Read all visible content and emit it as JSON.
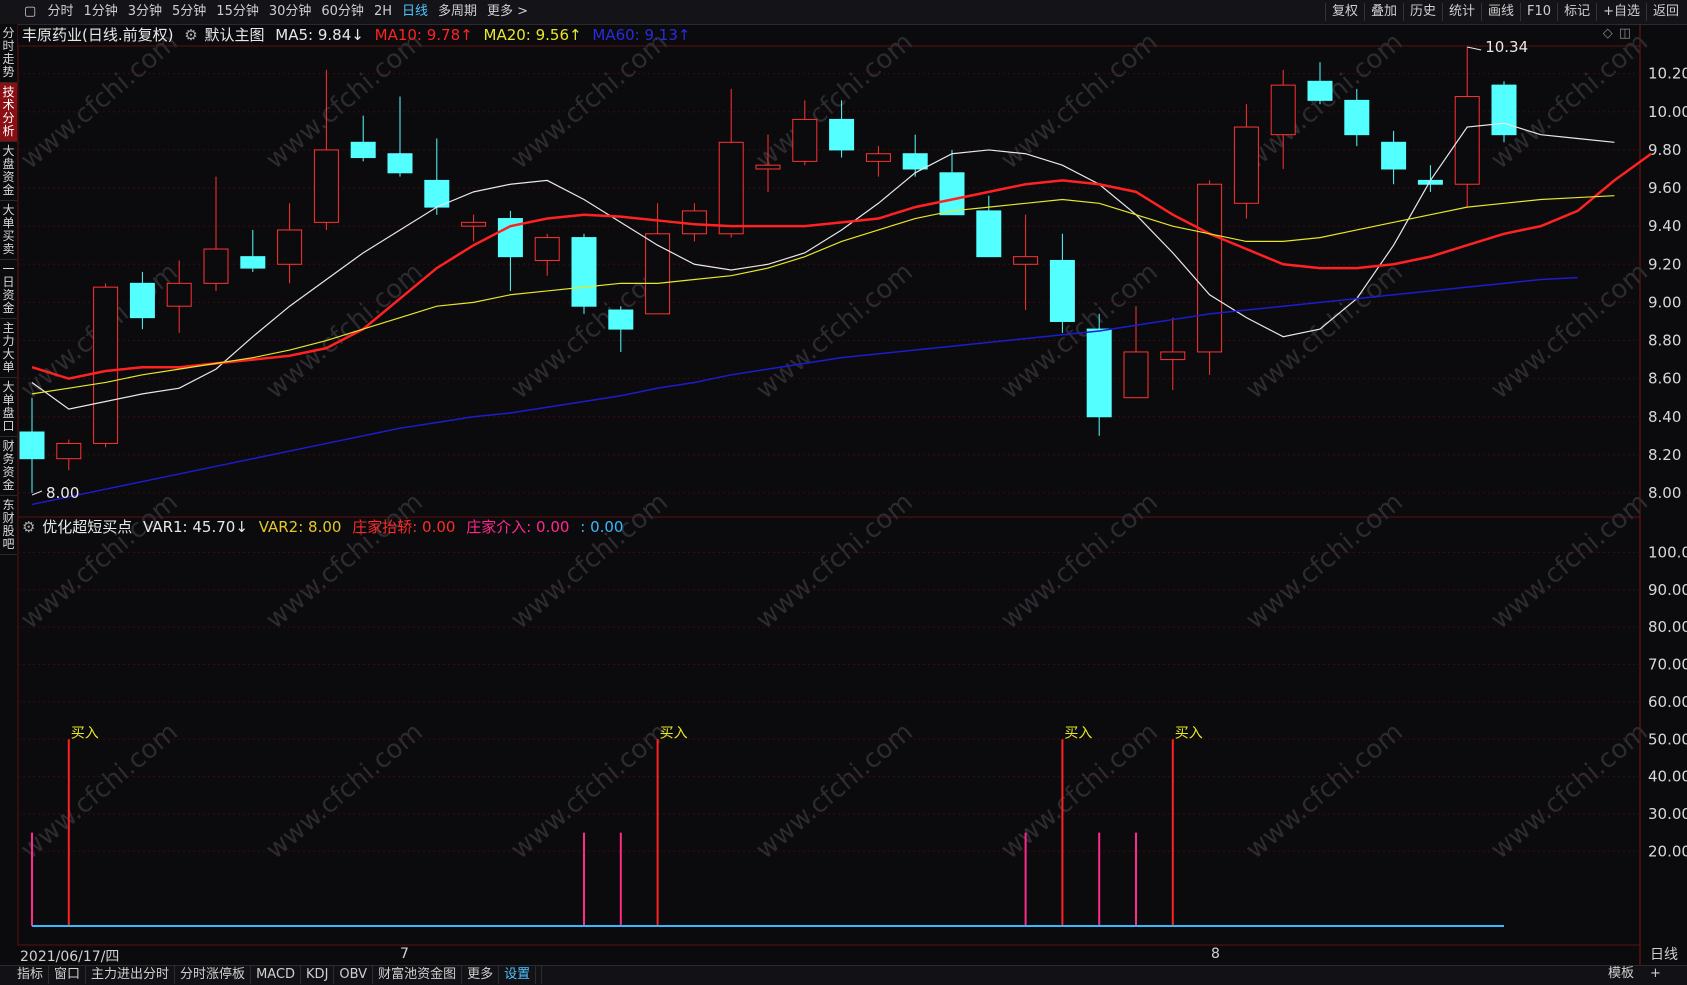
{
  "toolbar": {
    "periods": [
      "分时",
      "1分钟",
      "3分钟",
      "5分钟",
      "15分钟",
      "30分钟",
      "60分钟",
      "2H",
      "日线",
      "多周期",
      "更多 >"
    ],
    "active_period": "日线",
    "right_items": [
      "复权",
      "叠加",
      "历史",
      "统计",
      "画线",
      "F10",
      "标记",
      "+自选",
      "返回"
    ]
  },
  "side_tabs": [
    {
      "label": "分时走势",
      "selected": false
    },
    {
      "label": "技术分析",
      "selected": true
    },
    {
      "label": "大盘资金",
      "selected": false
    },
    {
      "label": "大单买卖",
      "selected": false
    },
    {
      "label": "一日资金",
      "selected": false
    },
    {
      "label": "主力大单",
      "selected": false
    },
    {
      "label": "大单盘口",
      "selected": false
    },
    {
      "label": "财务资金",
      "selected": false
    },
    {
      "label": "东财股吧",
      "selected": false
    }
  ],
  "main_info": {
    "stock": "丰原药业(日线.前复权)",
    "template": "默认主图",
    "ma5": "MA5: 9.84↓",
    "ma10": "MA10: 9.78↑",
    "ma20": "MA20: 9.56↑",
    "ma60": "MA60: 9.13↑"
  },
  "sub_info": {
    "name": "优化超短买点",
    "var1": "VAR1: 45.70↓",
    "var2": "VAR2: 8.00",
    "zjtq": "庄家抬轿: 0.00",
    "zjjr": "庄家介入: 0.00",
    "extra": ": 0.00"
  },
  "dates": {
    "start": "2021/06/17/四",
    "m7": "7",
    "m8": "8"
  },
  "bottom_tabs": [
    "指标",
    "窗口",
    "主力进出分时",
    "分时涨停板",
    "MACD",
    "KDJ",
    "OBV",
    "财富池资金图",
    "更多",
    "设置"
  ],
  "bottom_selected": "设置",
  "bottom_right": {
    "template": "模板",
    "plus": "+",
    "period": "日线"
  },
  "watermark": "www.cfchi.com",
  "colors": {
    "up": "#ff3333",
    "down": "#54ffff",
    "ma5": "#e8e8e8",
    "ma10": "#ff2222",
    "ma20": "#e6e62a",
    "ma60": "#1c1cd0",
    "grid": "#3a0c0c"
  },
  "chart_data": [
    {
      "type": "candlestick",
      "title": "丰原药业(日线.前复权)",
      "ylim": [
        7.88,
        10.34
      ],
      "y_ticks": [
        "10.20",
        "10.00",
        "9.80",
        "9.60",
        "9.40",
        "9.20",
        "9.00",
        "8.80",
        "8.60",
        "8.40",
        "8.20",
        "8.00"
      ],
      "high_label": "10.34",
      "low_label": "8.00",
      "candles": [
        {
          "o": 8.32,
          "h": 8.5,
          "l": 8.0,
          "c": 8.18
        },
        {
          "o": 8.18,
          "h": 8.28,
          "l": 8.12,
          "c": 8.26
        },
        {
          "o": 8.26,
          "h": 9.1,
          "l": 8.24,
          "c": 9.08
        },
        {
          "o": 9.1,
          "h": 9.16,
          "l": 8.86,
          "c": 8.92
        },
        {
          "o": 8.98,
          "h": 9.22,
          "l": 8.84,
          "c": 9.1
        },
        {
          "o": 9.1,
          "h": 9.66,
          "l": 9.06,
          "c": 9.28
        },
        {
          "o": 9.24,
          "h": 9.38,
          "l": 9.16,
          "c": 9.18
        },
        {
          "o": 9.2,
          "h": 9.52,
          "l": 9.1,
          "c": 9.38
        },
        {
          "o": 9.42,
          "h": 10.22,
          "l": 9.38,
          "c": 9.8
        },
        {
          "o": 9.84,
          "h": 9.98,
          "l": 9.74,
          "c": 9.76
        },
        {
          "o": 9.78,
          "h": 10.08,
          "l": 9.66,
          "c": 9.68
        },
        {
          "o": 9.64,
          "h": 9.86,
          "l": 9.46,
          "c": 9.5
        },
        {
          "o": 9.4,
          "h": 9.46,
          "l": 9.32,
          "c": 9.42
        },
        {
          "o": 9.44,
          "h": 9.48,
          "l": 9.06,
          "c": 9.24
        },
        {
          "o": 9.22,
          "h": 9.36,
          "l": 9.14,
          "c": 9.34
        },
        {
          "o": 9.34,
          "h": 9.36,
          "l": 8.94,
          "c": 8.98
        },
        {
          "o": 8.96,
          "h": 8.98,
          "l": 8.74,
          "c": 8.86
        },
        {
          "o": 8.94,
          "h": 9.52,
          "l": 8.94,
          "c": 9.36
        },
        {
          "o": 9.36,
          "h": 9.52,
          "l": 9.32,
          "c": 9.48
        },
        {
          "o": 9.36,
          "h": 10.12,
          "l": 9.34,
          "c": 9.84
        },
        {
          "o": 9.7,
          "h": 9.88,
          "l": 9.58,
          "c": 9.72
        },
        {
          "o": 9.74,
          "h": 10.06,
          "l": 9.72,
          "c": 9.96
        },
        {
          "o": 9.96,
          "h": 10.06,
          "l": 9.76,
          "c": 9.8
        },
        {
          "o": 9.74,
          "h": 9.82,
          "l": 9.66,
          "c": 9.78
        },
        {
          "o": 9.78,
          "h": 9.88,
          "l": 9.66,
          "c": 9.7
        },
        {
          "o": 9.68,
          "h": 9.8,
          "l": 9.46,
          "c": 9.46
        },
        {
          "o": 9.48,
          "h": 9.56,
          "l": 9.24,
          "c": 9.24
        },
        {
          "o": 9.2,
          "h": 9.46,
          "l": 8.96,
          "c": 9.24
        },
        {
          "o": 9.22,
          "h": 9.36,
          "l": 8.84,
          "c": 8.9
        },
        {
          "o": 8.86,
          "h": 8.94,
          "l": 8.3,
          "c": 8.4
        },
        {
          "o": 8.5,
          "h": 8.98,
          "l": 8.5,
          "c": 8.74
        },
        {
          "o": 8.7,
          "h": 8.92,
          "l": 8.54,
          "c": 8.74
        },
        {
          "o": 8.74,
          "h": 9.64,
          "l": 8.62,
          "c": 9.62
        },
        {
          "o": 9.52,
          "h": 10.04,
          "l": 9.44,
          "c": 9.92
        },
        {
          "o": 9.88,
          "h": 10.22,
          "l": 9.7,
          "c": 10.14
        },
        {
          "o": 10.16,
          "h": 10.26,
          "l": 10.04,
          "c": 10.06
        },
        {
          "o": 10.06,
          "h": 10.12,
          "l": 9.82,
          "c": 9.88
        },
        {
          "o": 9.84,
          "h": 9.9,
          "l": 9.62,
          "c": 9.7
        },
        {
          "o": 9.64,
          "h": 9.72,
          "l": 9.58,
          "c": 9.62
        },
        {
          "o": 9.62,
          "h": 10.34,
          "l": 9.5,
          "c": 10.08
        },
        {
          "o": 10.14,
          "h": 10.16,
          "l": 9.84,
          "c": 9.88
        }
      ],
      "ma_series": [
        {
          "name": "MA5",
          "color": "#e8e8e8",
          "values": [
            8.58,
            8.44,
            8.48,
            8.52,
            8.55,
            8.65,
            8.82,
            8.98,
            9.12,
            9.26,
            9.38,
            9.5,
            9.58,
            9.62,
            9.64,
            9.54,
            9.42,
            9.3,
            9.2,
            9.17,
            9.2,
            9.26,
            9.38,
            9.52,
            9.68,
            9.78,
            9.8,
            9.78,
            9.72,
            9.62,
            9.46,
            9.26,
            9.04,
            8.92,
            8.82,
            8.86,
            9.02,
            9.3,
            9.64,
            9.92,
            9.94,
            9.88,
            9.86,
            9.84
          ]
        },
        {
          "name": "MA10",
          "color": "#ff2222",
          "values": [
            8.66,
            8.6,
            8.64,
            8.66,
            8.66,
            8.68,
            8.7,
            8.72,
            8.76,
            8.86,
            9.02,
            9.18,
            9.3,
            9.4,
            9.44,
            9.46,
            9.45,
            9.43,
            9.41,
            9.4,
            9.4,
            9.4,
            9.42,
            9.44,
            9.5,
            9.54,
            9.58,
            9.62,
            9.64,
            9.62,
            9.58,
            9.46,
            9.36,
            9.28,
            9.2,
            9.18,
            9.18,
            9.2,
            9.24,
            9.3,
            9.36,
            9.4,
            9.48,
            9.64,
            9.78
          ]
        },
        {
          "name": "MA20",
          "color": "#e6e62a",
          "values": [
            8.52,
            8.55,
            8.58,
            8.62,
            8.65,
            8.68,
            8.71,
            8.75,
            8.8,
            8.86,
            8.92,
            8.98,
            9.0,
            9.04,
            9.06,
            9.08,
            9.1,
            9.1,
            9.12,
            9.14,
            9.18,
            9.24,
            9.32,
            9.38,
            9.44,
            9.48,
            9.5,
            9.52,
            9.54,
            9.52,
            9.46,
            9.4,
            9.36,
            9.32,
            9.32,
            9.34,
            9.38,
            9.42,
            9.46,
            9.5,
            9.52,
            9.54,
            9.55,
            9.56
          ]
        },
        {
          "name": "MA60",
          "color": "#1c1cd0",
          "values": [
            7.94,
            7.98,
            8.02,
            8.06,
            8.1,
            8.14,
            8.18,
            8.22,
            8.26,
            8.3,
            8.34,
            8.37,
            8.4,
            8.42,
            8.45,
            8.48,
            8.51,
            8.55,
            8.58,
            8.62,
            8.65,
            8.68,
            8.71,
            8.73,
            8.75,
            8.77,
            8.79,
            8.81,
            8.83,
            8.85,
            8.88,
            8.91,
            8.94,
            8.96,
            8.98,
            9.0,
            9.02,
            9.04,
            9.06,
            9.08,
            9.1,
            9.12,
            9.13
          ]
        }
      ]
    },
    {
      "type": "bar",
      "title": "优化超短买点",
      "ylim": [
        0,
        110
      ],
      "y_ticks": [
        "100.00",
        "90.00",
        "80.00",
        "70.00",
        "60.00",
        "50.00",
        "40.00",
        "30.00",
        "20.00"
      ],
      "signal_label": "买入",
      "signals": [
        {
          "bar": 0,
          "value": 25,
          "kind": "minor"
        },
        {
          "bar": 1,
          "value": 50,
          "kind": "buy"
        },
        {
          "bar": 15,
          "value": 25,
          "kind": "minor"
        },
        {
          "bar": 16,
          "value": 25,
          "kind": "minor"
        },
        {
          "bar": 17,
          "value": 50,
          "kind": "buy"
        },
        {
          "bar": 27,
          "value": 25,
          "kind": "minor"
        },
        {
          "bar": 28,
          "value": 50,
          "kind": "buy"
        },
        {
          "bar": 29,
          "value": 25,
          "kind": "minor"
        },
        {
          "bar": 30,
          "value": 25,
          "kind": "minor"
        },
        {
          "bar": 31,
          "value": 50,
          "kind": "buy"
        }
      ],
      "baseline_value": 0.0
    }
  ]
}
